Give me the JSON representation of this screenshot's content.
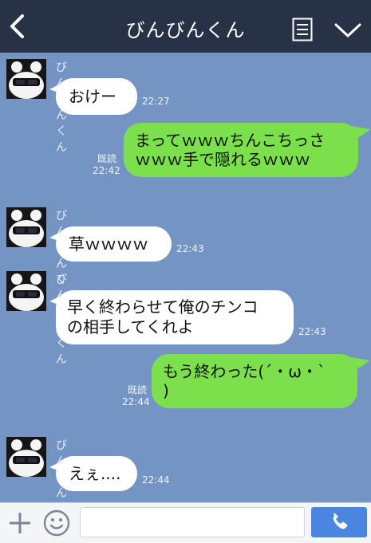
{
  "header": {
    "title": "びんびんくん",
    "back_icon": "chevron-left-icon",
    "menu_icon": "list-icon",
    "expand_icon": "chevron-down-icon"
  },
  "messages": [
    {
      "side": "left",
      "sender": "びんびんくん",
      "text": "おけー",
      "time": "22:27"
    },
    {
      "side": "right",
      "read": "既読",
      "text": "まってｗｗｗちんこちっさ\nｗｗｗ手で隠れるｗｗｗ",
      "time": "22:42"
    },
    {
      "side": "left",
      "sender": "びんびんくん",
      "text": "草ｗｗｗｗ",
      "time": "22:43"
    },
    {
      "side": "left",
      "sender": "びんびんくん",
      "text": "早く終わらせて俺のチンコ\nの相手してくれよ",
      "time": "22:43"
    },
    {
      "side": "right",
      "read": "既読",
      "text": "もう終わった(´・ω・`\n)",
      "time": "22:44"
    },
    {
      "side": "left",
      "sender": "びんびんくん",
      "text": "えぇ....",
      "time": "22:44"
    }
  ],
  "footer": {
    "plus_icon": "plus-icon",
    "sticker_icon": "smiley-icon",
    "input_value": "",
    "call_icon": "phone-icon"
  },
  "colors": {
    "header_bg": "#273246",
    "chat_bg": "#7494c4",
    "bubble_green": "#7be04c",
    "bubble_white": "#ffffff",
    "call_button": "#4a86e0"
  }
}
